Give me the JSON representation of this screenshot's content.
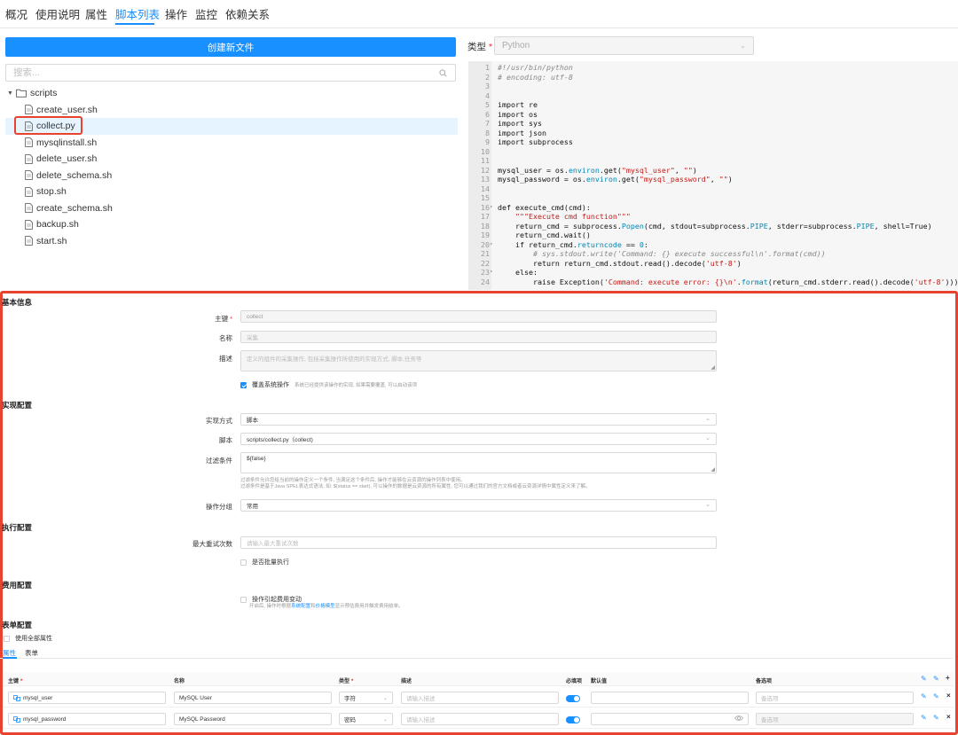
{
  "nav": {
    "tabs": [
      "概况",
      "使用说明",
      "属性",
      "脚本列表",
      "操作",
      "监控",
      "依赖关系"
    ],
    "active": "脚本列表"
  },
  "files": {
    "create_button": "创建新文件",
    "search_placeholder": "搜索...",
    "folder": "scripts",
    "items": [
      "create_user.sh",
      "collect.py",
      "mysqlinstall.sh",
      "delete_user.sh",
      "delete_schema.sh",
      "stop.sh",
      "create_schema.sh",
      "backup.sh",
      "start.sh"
    ],
    "selected": "collect.py"
  },
  "editor": {
    "type_label": "类型",
    "type_value": "Python",
    "lines": [
      "#!/usr/bin/python",
      "# encoding: utf-8",
      "",
      "",
      "import re",
      "import os",
      "import sys",
      "import json",
      "import subprocess",
      "",
      "",
      "mysql_user = os.environ.get(\"mysql_user\", \"\")",
      "mysql_password = os.environ.get(\"mysql_password\", \"\")",
      "",
      "",
      "def execute_cmd(cmd):",
      "    \"\"\"Execute cmd function\"\"\"",
      "    return_cmd = subprocess.Popen(cmd, stdout=subprocess.PIPE, stderr=subprocess.PIPE, shell=True)",
      "    return_cmd.wait()",
      "    if return_cmd.returncode == 0:",
      "        # sys.stdout.write('Command: {} execute successful\\n'.format(cmd))",
      "        return return_cmd.stdout.read().decode('utf-8')",
      "    else:",
      "        raise Exception('Command: execute error: {}\\n'.format(return_cmd.stderr.read().decode('utf-8')))"
    ],
    "fold_lines": [
      16,
      20,
      23
    ]
  },
  "config": {
    "basic": {
      "title": "基本信息",
      "key_label": "主键",
      "key_value": "collect",
      "name_label": "名称",
      "name_value": "采集",
      "desc_label": "描述",
      "desc_value": "定义的组件的采集操作, 包括采集操作所使用的实现方式, 脚本,任务等",
      "override_label": "覆盖系统操作",
      "override_hint": "系统已经提供该操作的实现, 如果需要覆盖, 可以启动该项"
    },
    "impl": {
      "title": "实现配置",
      "method_label": "实现方式",
      "method_value": "脚本",
      "script_label": "脚本",
      "script_value": "scripts/collect.py（collect)",
      "filter_label": "过滤条件",
      "filter_value": "${false}",
      "filter_hint1": "过滤条件允许您给当前的操作定义一个条件, 当满足这个条件后, 操作才能够在云资源的操作列表中使用。",
      "filter_hint2": "过滤条件是基于Java SPEL表达式语法, 如: $(status == start), 可以操作的数据是云资源的所有属性, 您可以通过我们的官方文档或者云资源详情中属性定义来了解。",
      "group_label": "操作分组",
      "group_value": "常用"
    },
    "exec": {
      "title": "执行配置",
      "retry_label": "最大重试次数",
      "retry_placeholder": "请输入最大重试次数",
      "batch_label": "是否批量执行"
    },
    "cost": {
      "title": "费用配置",
      "change_label": "操作引起费用变动",
      "hint_pre": "开启后, 操作时根据",
      "hint_link1": "系统配置",
      "hint_mid": "和",
      "hint_link2": "价格模型",
      "hint_post": "显示预估费用并触发费用结单。"
    },
    "form": {
      "title": "表单配置",
      "use_all": "使用全部属性",
      "tabs": [
        "属性",
        "表单"
      ],
      "columns": [
        "主键",
        "名称",
        "类型",
        "描述",
        "必填项",
        "默认值",
        "备选项"
      ],
      "rows": [
        {
          "key": "mysql_user",
          "name": "MySQL User",
          "type": "字符",
          "desc_placeholder": "请输入描述",
          "options_placeholder": "备选项"
        },
        {
          "key": "mysql_password",
          "name": "MySQL Password",
          "type": "密码",
          "desc_placeholder": "请输入描述",
          "options_placeholder": "备选项"
        }
      ]
    }
  },
  "colors": {
    "primary": "#1890ff",
    "highlight": "#e8432f",
    "required": "#f5222d"
  }
}
